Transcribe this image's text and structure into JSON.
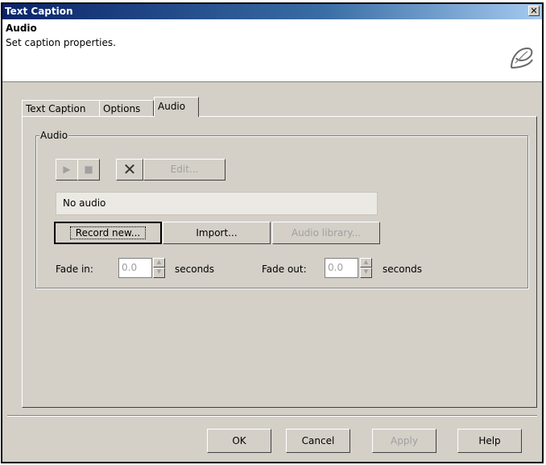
{
  "window": {
    "title": "Text Caption",
    "close_label": "✕"
  },
  "header": {
    "title": "Audio",
    "subtitle": "Set caption properties.",
    "logo_icon": "captivate-logo-icon"
  },
  "tabs": [
    {
      "label": "Text Caption"
    },
    {
      "label": "Options"
    },
    {
      "label": "Audio",
      "active": true
    }
  ],
  "audio_group": {
    "label": "Audio",
    "toolbar": {
      "play_icon": "▶",
      "stop_icon": "■",
      "delete_icon": "✕",
      "edit_label": "Edit..."
    },
    "status_text": "No audio",
    "record_label": "Record new...",
    "import_label": "Import...",
    "library_label": "Audio library...",
    "fade_in_label": "Fade in:",
    "fade_in_value": "0.0",
    "fade_in_unit": "seconds",
    "fade_out_label": "Fade out:",
    "fade_out_value": "0.0",
    "fade_out_unit": "seconds"
  },
  "footer": {
    "ok": "OK",
    "cancel": "Cancel",
    "apply": "Apply",
    "help": "Help"
  },
  "colors": {
    "title_bar": "#0a246a",
    "dialog_bg": "#d4d0c8"
  }
}
